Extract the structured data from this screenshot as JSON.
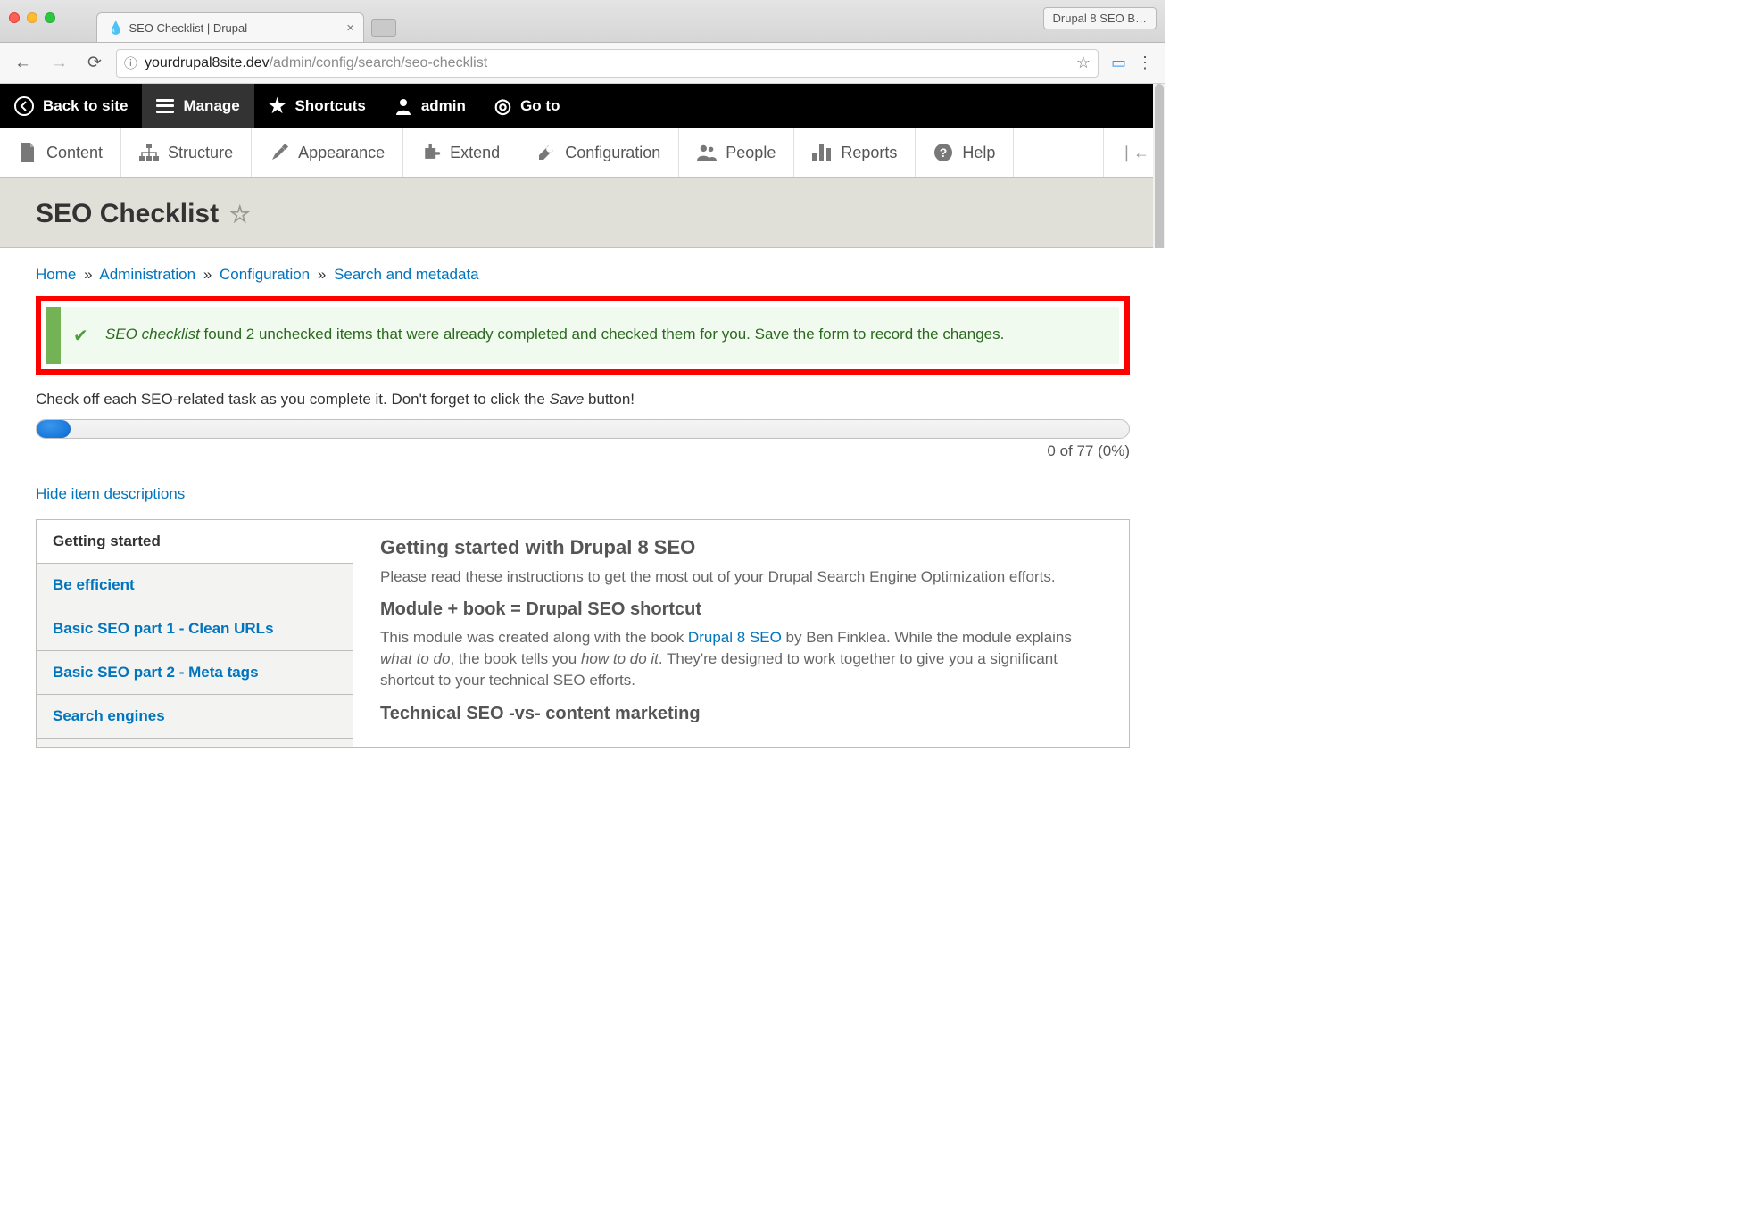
{
  "browser": {
    "tab_title": "SEO Checklist | Drupal",
    "user_label": "Drupal 8 SEO B…",
    "url_host": "yourdrupal8site.dev",
    "url_path": "/admin/config/search/seo-checklist"
  },
  "drupal_toolbar": {
    "back": "Back to site",
    "manage": "Manage",
    "shortcuts": "Shortcuts",
    "admin": "admin",
    "goto": "Go to"
  },
  "admin_menu": {
    "content": "Content",
    "structure": "Structure",
    "appearance": "Appearance",
    "extend": "Extend",
    "configuration": "Configuration",
    "people": "People",
    "reports": "Reports",
    "help": "Help"
  },
  "page": {
    "title": "SEO Checklist",
    "breadcrumb": {
      "home": "Home",
      "admin": "Administration",
      "config": "Configuration",
      "search": "Search and metadata"
    }
  },
  "status": {
    "prefix": "SEO checklist",
    "message": " found 2 unchecked items that were already completed and checked them for you. Save the form to record the changes."
  },
  "intro": {
    "before": "Check off each SEO-related task as you complete it. Don't forget to click the ",
    "em": "Save",
    "after": " button!"
  },
  "progress": {
    "text": "0 of 77 (0%)"
  },
  "toggle_link": "Hide item descriptions",
  "tabs": {
    "items": [
      {
        "label": "Getting started"
      },
      {
        "label": "Be efficient"
      },
      {
        "label": "Basic SEO part 1 - Clean URLs"
      },
      {
        "label": "Basic SEO part 2 - Meta tags"
      },
      {
        "label": "Search engines"
      }
    ]
  },
  "content_panel": {
    "h2": "Getting started with Drupal 8 SEO",
    "p1": "Please read these instructions to get the most out of your Drupal Search Engine Optimization efforts.",
    "h3a": "Module + book = Drupal SEO shortcut",
    "p2a": "This module was created along with the book ",
    "p2link": "Drupal 8 SEO",
    "p2b": " by Ben Finklea. While the module explains ",
    "p2em1": "what to do",
    "p2c": ", the book tells you ",
    "p2em2": "how to do it",
    "p2d": ". They're designed to work together to give you a significant shortcut to your technical SEO efforts.",
    "h3b": "Technical SEO -vs- content marketing"
  }
}
